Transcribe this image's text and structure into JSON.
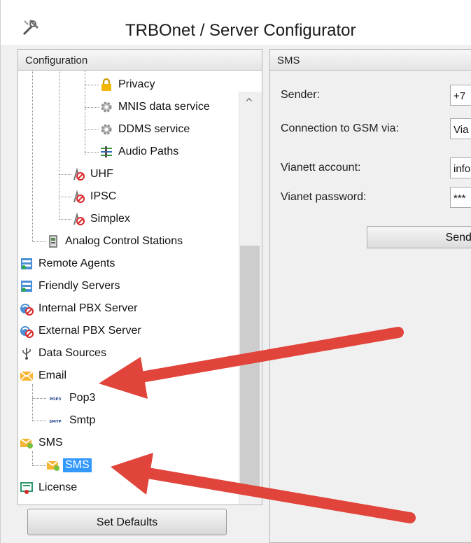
{
  "window": {
    "title": "TRBOnet / Server Configurator"
  },
  "left_panel": {
    "header": "Configuration"
  },
  "tree": [
    {
      "label": "Privacy",
      "icon": "lock-icon"
    },
    {
      "label": "MNIS data service",
      "icon": "gear-icon"
    },
    {
      "label": "DDMS service",
      "icon": "gear-icon"
    },
    {
      "label": "Audio Paths",
      "icon": "audio-paths-icon"
    },
    {
      "label": "UHF",
      "icon": "radio-tower-disabled-icon"
    },
    {
      "label": "IPSC",
      "icon": "radio-tower-disabled-icon"
    },
    {
      "label": "Simplex",
      "icon": "radio-tower-disabled-icon"
    },
    {
      "label": "Analog Control Stations",
      "icon": "control-station-icon"
    },
    {
      "label": "Remote Agents",
      "icon": "server-icon"
    },
    {
      "label": "Friendly Servers",
      "icon": "server-icon"
    },
    {
      "label": "Internal PBX Server",
      "icon": "pbx-icon"
    },
    {
      "label": "External PBX Server",
      "icon": "pbx-icon"
    },
    {
      "label": "Data Sources",
      "icon": "usb-icon"
    },
    {
      "label": "Email",
      "icon": "envelope-icon"
    },
    {
      "label": "Pop3",
      "icon": "pop3-icon"
    },
    {
      "label": "Smtp",
      "icon": "smtp-icon"
    },
    {
      "label": "SMS",
      "icon": "sms-envelope-icon"
    },
    {
      "label": "SMS",
      "icon": "sms-envelope-icon",
      "selected": true
    },
    {
      "label": "License",
      "icon": "license-icon"
    }
  ],
  "right_panel": {
    "header": "SMS",
    "fields": [
      {
        "label": "Sender:",
        "value": "+7"
      },
      {
        "label": "Connection to GSM via:",
        "value": "Via"
      },
      {
        "label": "Vianett account:",
        "value": "info"
      },
      {
        "label": "Vianet password:",
        "value": "***"
      }
    ],
    "send_button": "Send Tes"
  },
  "footer": {
    "set_defaults": "Set Defaults"
  },
  "colors": {
    "selection": "#3399ff",
    "arrow": "#e0443a"
  }
}
